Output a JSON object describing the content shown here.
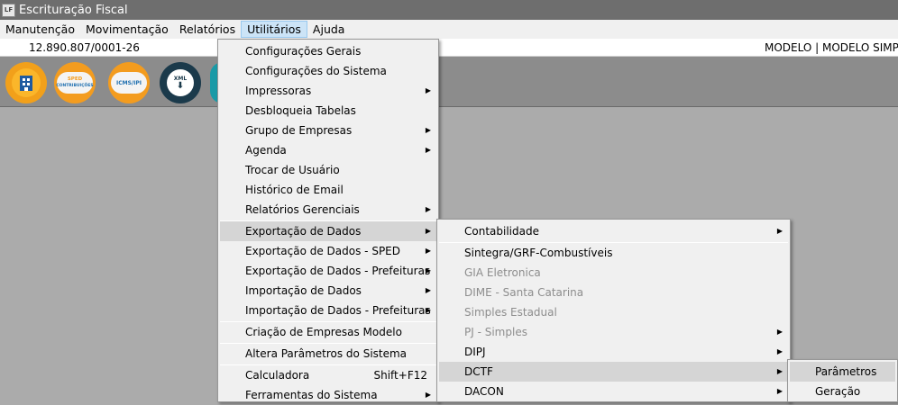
{
  "window": {
    "title": "Escrituração Fiscal",
    "icon_text": "LF"
  },
  "menubar": [
    "Manutenção",
    "Movimentação",
    "Relatórios",
    "Utilitários",
    "Ajuda"
  ],
  "info": {
    "cnpj": "12.890.807/0001-26",
    "model": "MODELO | MODELO SIMPLES"
  },
  "toolbar": {
    "sped_label": "SPED",
    "sped_sub": "CONTRIBUIÇÕES",
    "icms_label": "ICMS/IPI",
    "xml_label": "XML"
  },
  "utilitarios_menu": [
    "Configurações Gerais",
    "Configurações do Sistema",
    "Impressoras",
    "Desbloqueia Tabelas",
    "Grupo de Empresas",
    "Agenda",
    "Trocar de Usuário",
    "Histórico de Email",
    "Relatórios Gerenciais",
    "Exportação de Dados",
    "Exportação de Dados - SPED",
    "Exportação de Dados - Prefeituras",
    "Importação de Dados",
    "Importação de Dados - Prefeituras",
    "Criação de Empresas Modelo",
    "Altera Parâmetros do Sistema",
    "Calculadora",
    "Ferramentas do Sistema"
  ],
  "calculadora_shortcut": "Shift+F12",
  "exportacao_menu": [
    "Contabilidade",
    "Sintegra/GRF-Combustíveis",
    "GIA Eletronica",
    "DIME - Santa Catarina",
    "Simples Estadual",
    "PJ - Simples",
    "DIPJ",
    "DCTF",
    "DACON"
  ],
  "dctf_menu": [
    "Parâmetros",
    "Geração"
  ]
}
